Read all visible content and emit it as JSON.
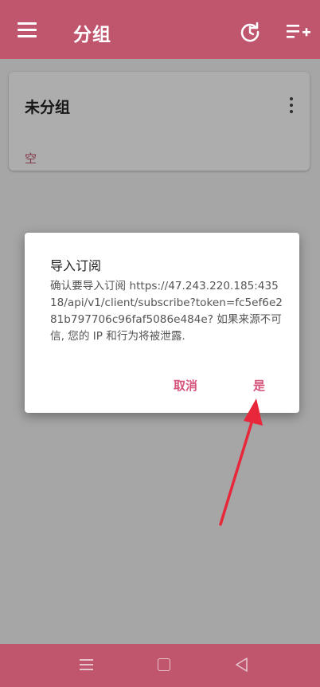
{
  "appbar": {
    "title": "分组",
    "icons": [
      "menu-icon",
      "refresh-icon",
      "add-list-icon"
    ]
  },
  "group_card": {
    "title": "未分组",
    "empty_text": "空",
    "icons": [
      "more-vert-icon"
    ]
  },
  "dialog": {
    "title": "导入订阅",
    "message": "确认要导入订阅 https://47.243.220.185:43518/api/v1/client/subscribe?token=fc5ef6e281b797706c96faf5086e484e? 如果来源不可信, 您的 IP 和行为将被泄露.",
    "cancel_label": "取消",
    "confirm_label": "是"
  },
  "navbar": {
    "icons": [
      "nav-menu-icon",
      "nav-home-icon",
      "nav-back-icon"
    ]
  },
  "colors": {
    "primary": "#c0556e",
    "accent": "#d5537b",
    "annotation_arrow": "#e8273a"
  }
}
